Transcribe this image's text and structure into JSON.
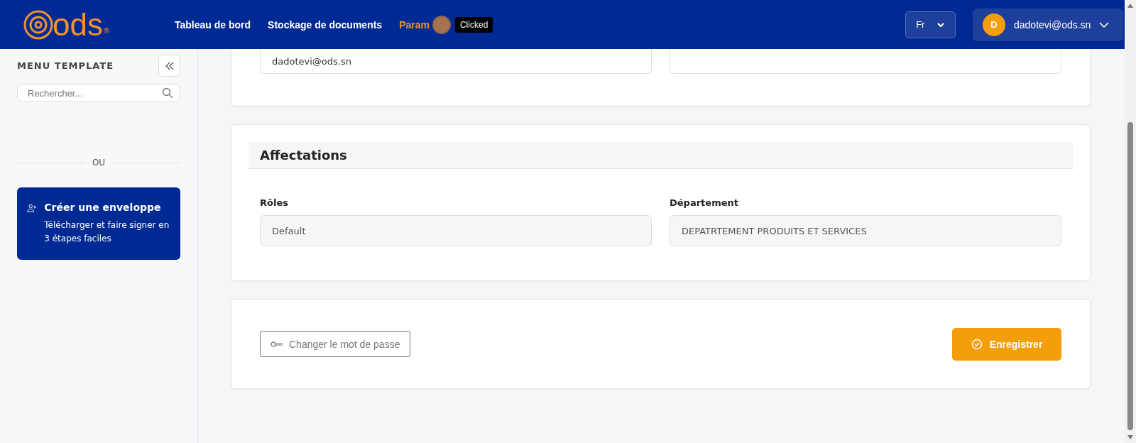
{
  "header": {
    "logo": "ods",
    "logo_mark": "®",
    "nav": [
      {
        "label": "Tableau de bord",
        "selected": false
      },
      {
        "label": "Stockage de documents",
        "selected": false
      },
      {
        "label": "Param",
        "selected": true
      }
    ],
    "click_marker": {
      "tooltip": "Clicked"
    },
    "language": "Fr",
    "user": {
      "initial": "D",
      "email": "dadotevi@ods.sn"
    }
  },
  "sidebar": {
    "title": "MENU TEMPLATE",
    "search": {
      "placeholder": "Rechercher..."
    },
    "divider": "OU",
    "create_card": {
      "title": "Créer une enveloppe",
      "description": "Télécharger et faire signer en 3 étapes faciles"
    }
  },
  "profile_card": {
    "fields": [
      {
        "kind": "filled",
        "value": "dadotevi@ods.sn"
      },
      {
        "kind": "empty"
      }
    ]
  },
  "assignments": {
    "title": "Affectations",
    "fields": [
      {
        "label": "Rôles",
        "value": "Default"
      },
      {
        "label": "Département",
        "value": "DEPATRTEMENT PRODUITS ET SERVICES"
      }
    ]
  },
  "actions": {
    "change_password": "Changer le mot de passe",
    "save": "Enregistrer"
  }
}
